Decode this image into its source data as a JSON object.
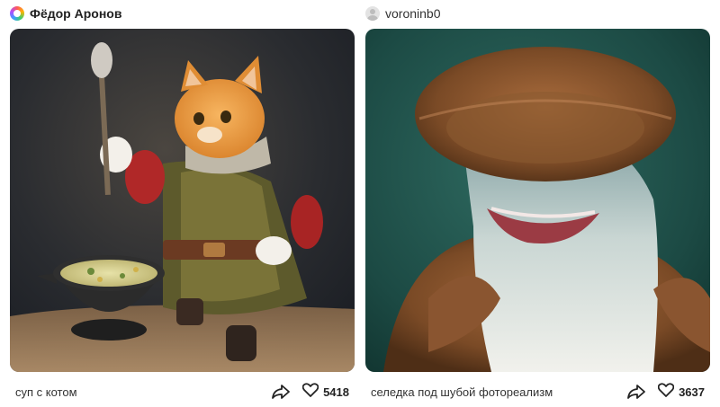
{
  "cards": [
    {
      "author": "Фёдор Аронов",
      "caption": "суп с котом",
      "likes": "5418",
      "image_alt": "",
      "icons": {
        "share": "share-arrow-icon",
        "like": "heart-outline-icon"
      }
    },
    {
      "author": "voroninb0",
      "caption": "селедка под шубой фотореализм",
      "likes": "3637",
      "image_alt": "",
      "icons": {
        "share": "share-arrow-icon",
        "like": "heart-outline-icon"
      }
    }
  ],
  "colors": {
    "text": "#1f1f1f",
    "background": "#ffffff"
  }
}
